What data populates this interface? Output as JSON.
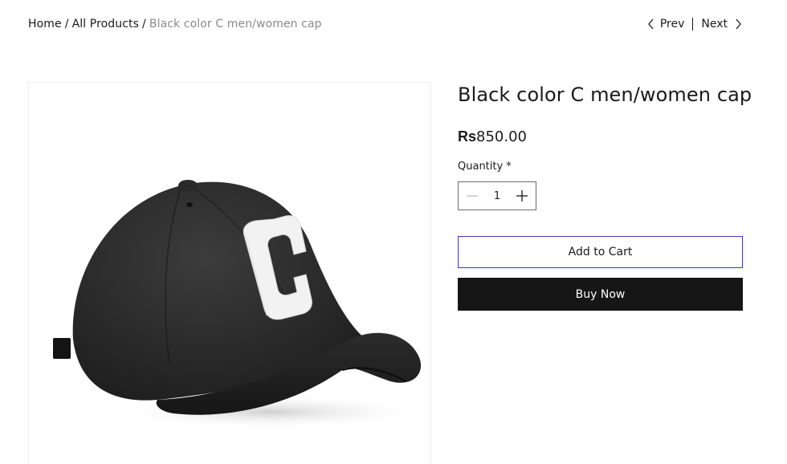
{
  "breadcrumb": {
    "home": "Home",
    "all_products": "All Products",
    "current": "Black color C men/women cap",
    "separator": "/"
  },
  "pager": {
    "prev_label": "Prev",
    "next_label": "Next"
  },
  "product": {
    "title": "Black color C men/women cap",
    "price_currency": "Rs",
    "price_amount": "850.00",
    "image_icon": "black-baseball-cap-with-white-letter-c"
  },
  "quantity": {
    "label": "Quantity *",
    "value": "1",
    "decrement_icon": "minus-icon",
    "increment_icon": "plus-icon"
  },
  "actions": {
    "add_to_cart": "Add to Cart",
    "buy_now": "Buy Now"
  },
  "colors": {
    "text": "#1a1a1a",
    "muted": "#8a8a8a",
    "buy_now_bg": "#161616",
    "add_to_cart_border": "#3b3bb3"
  }
}
